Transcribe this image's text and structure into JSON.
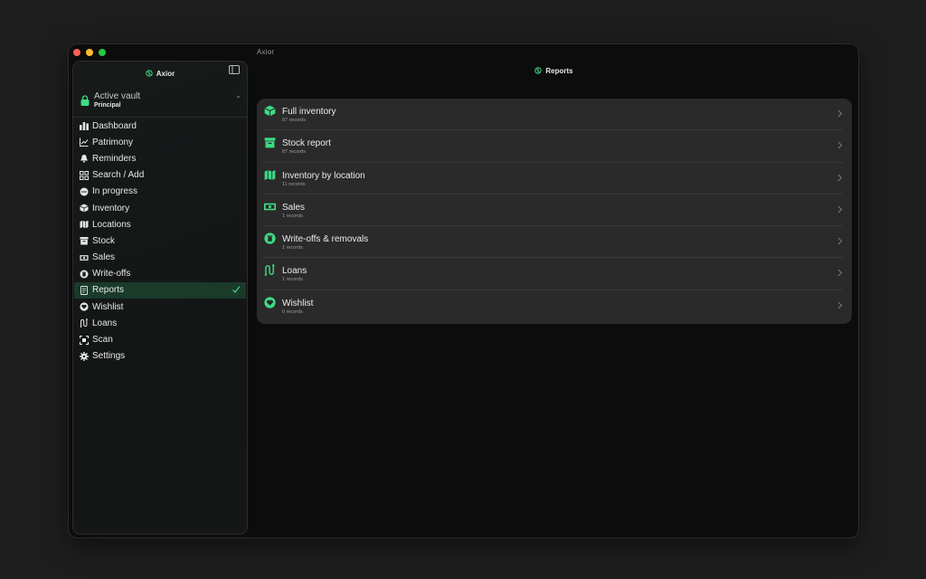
{
  "window": {
    "title": "Axior"
  },
  "sidebar": {
    "app_name": "Axior",
    "vault": {
      "title": "Active vault",
      "subtitle": "Principal"
    },
    "items": [
      {
        "label": "Dashboard",
        "icon": "chart-bar-icon"
      },
      {
        "label": "Patrimony",
        "icon": "trend-chart-icon"
      },
      {
        "label": "Reminders",
        "icon": "bell-icon"
      },
      {
        "label": "Search / Add",
        "icon": "grid-icon"
      },
      {
        "label": "In progress",
        "icon": "ellipsis-circle-icon"
      },
      {
        "label": "Inventory",
        "icon": "box-icon"
      },
      {
        "label": "Locations",
        "icon": "map-icon"
      },
      {
        "label": "Stock",
        "icon": "archive-box-icon"
      },
      {
        "label": "Sales",
        "icon": "banknote-icon"
      },
      {
        "label": "Write-offs",
        "icon": "trash-circle-icon"
      },
      {
        "label": "Reports",
        "icon": "report-icon",
        "active": true
      },
      {
        "label": "Wishlist",
        "icon": "heart-icon"
      },
      {
        "label": "Loans",
        "icon": "path-icon"
      },
      {
        "label": "Scan",
        "icon": "scan-icon"
      },
      {
        "label": "Settings",
        "icon": "gear-icon"
      }
    ]
  },
  "main": {
    "title": "Reports",
    "reports": [
      {
        "title": "Full inventory",
        "subtitle": "87 records",
        "icon": "box-icon"
      },
      {
        "title": "Stock report",
        "subtitle": "87 records",
        "icon": "archive-box-icon"
      },
      {
        "title": "Inventory by location",
        "subtitle": "11 records",
        "icon": "map-icon"
      },
      {
        "title": "Sales",
        "subtitle": "1 records",
        "icon": "banknote-icon"
      },
      {
        "title": "Write-offs & removals",
        "subtitle": "1 records",
        "icon": "trash-circle-icon"
      },
      {
        "title": "Loans",
        "subtitle": "1 records",
        "icon": "path-icon"
      },
      {
        "title": "Wishlist",
        "subtitle": "0 records",
        "icon": "heart-circle-icon"
      }
    ]
  },
  "colors": {
    "accent": "#3ddc84",
    "background": "#0c0c0d",
    "card": "#2a2a2b",
    "active_item": "#1a3a2a"
  }
}
